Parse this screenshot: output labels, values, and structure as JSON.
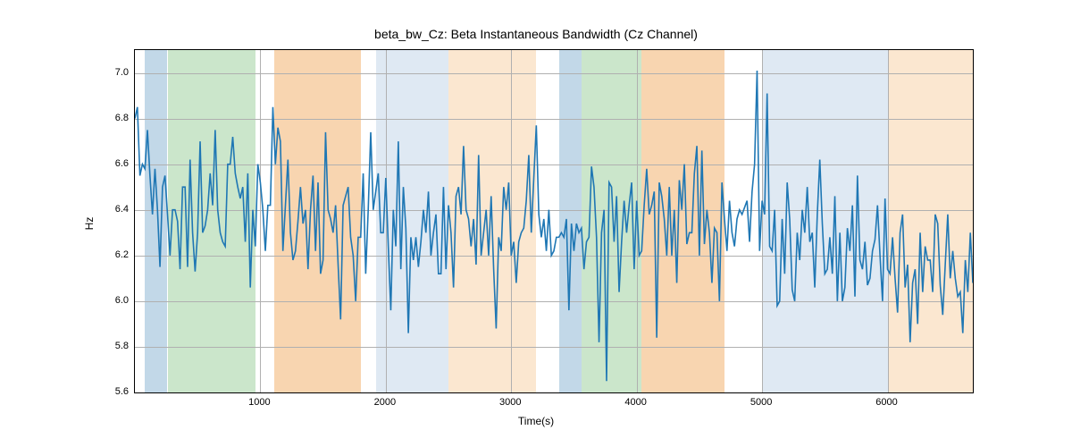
{
  "chart_data": {
    "type": "line",
    "title": "beta_bw_Cz: Beta Instantaneous Bandwidth (Cz Channel)",
    "xlabel": "Time(s)",
    "ylabel": "Hz",
    "xlim": [
      0,
      6680
    ],
    "ylim": [
      5.6,
      7.1
    ],
    "xticks": [
      1000,
      2000,
      3000,
      4000,
      5000,
      6000
    ],
    "yticks": [
      5.6,
      5.8,
      6.0,
      6.2,
      6.4,
      6.6,
      6.8,
      7.0
    ],
    "line_color": "#1f77b4",
    "bands": [
      {
        "x0": 80,
        "x1": 260,
        "color": "#c2d8e8"
      },
      {
        "x0": 260,
        "x1": 960,
        "color": "#cbe6cb"
      },
      {
        "x0": 1110,
        "x1": 1800,
        "color": "#f8d5b0"
      },
      {
        "x0": 1920,
        "x1": 2100,
        "color": "#dfe9f3"
      },
      {
        "x0": 2100,
        "x1": 2500,
        "color": "#dfe9f3"
      },
      {
        "x0": 2500,
        "x1": 3200,
        "color": "#fbe7d0"
      },
      {
        "x0": 3380,
        "x1": 3560,
        "color": "#c2d8e8"
      },
      {
        "x0": 3560,
        "x1": 4040,
        "color": "#cbe6cb"
      },
      {
        "x0": 4040,
        "x1": 4700,
        "color": "#f8d5b0"
      },
      {
        "x0": 5000,
        "x1": 6000,
        "color": "#dfe9f3"
      },
      {
        "x0": 6000,
        "x1": 6680,
        "color": "#fbe7d0"
      }
    ],
    "x": [
      0,
      20,
      40,
      60,
      80,
      100,
      120,
      140,
      160,
      180,
      200,
      220,
      240,
      260,
      280,
      300,
      320,
      340,
      360,
      380,
      400,
      420,
      440,
      460,
      480,
      500,
      520,
      540,
      560,
      580,
      600,
      620,
      640,
      660,
      680,
      700,
      720,
      740,
      760,
      780,
      800,
      820,
      840,
      860,
      880,
      900,
      920,
      940,
      960,
      980,
      1000,
      1020,
      1040,
      1060,
      1080,
      1100,
      1120,
      1140,
      1160,
      1180,
      1200,
      1220,
      1240,
      1260,
      1280,
      1300,
      1320,
      1340,
      1360,
      1380,
      1400,
      1420,
      1440,
      1460,
      1480,
      1500,
      1520,
      1540,
      1560,
      1580,
      1600,
      1620,
      1640,
      1660,
      1680,
      1700,
      1720,
      1740,
      1760,
      1780,
      1800,
      1820,
      1840,
      1860,
      1880,
      1900,
      1920,
      1940,
      1960,
      1980,
      2000,
      2020,
      2040,
      2060,
      2080,
      2100,
      2120,
      2140,
      2160,
      2180,
      2200,
      2220,
      2240,
      2260,
      2280,
      2300,
      2320,
      2340,
      2360,
      2380,
      2400,
      2420,
      2440,
      2460,
      2480,
      2500,
      2520,
      2540,
      2560,
      2580,
      2600,
      2620,
      2640,
      2660,
      2680,
      2700,
      2720,
      2740,
      2760,
      2780,
      2800,
      2820,
      2840,
      2860,
      2880,
      2900,
      2920,
      2940,
      2960,
      2980,
      3000,
      3020,
      3040,
      3060,
      3080,
      3100,
      3120,
      3140,
      3160,
      3180,
      3200,
      3220,
      3240,
      3260,
      3280,
      3300,
      3320,
      3340,
      3360,
      3380,
      3400,
      3420,
      3440,
      3460,
      3480,
      3500,
      3520,
      3540,
      3560,
      3580,
      3600,
      3620,
      3640,
      3660,
      3680,
      3700,
      3720,
      3740,
      3760,
      3780,
      3800,
      3820,
      3840,
      3860,
      3880,
      3900,
      3920,
      3940,
      3960,
      3980,
      4000,
      4020,
      4040,
      4060,
      4080,
      4100,
      4120,
      4140,
      4160,
      4180,
      4200,
      4220,
      4240,
      4260,
      4280,
      4300,
      4320,
      4340,
      4360,
      4380,
      4400,
      4420,
      4440,
      4460,
      4480,
      4500,
      4520,
      4540,
      4560,
      4580,
      4600,
      4620,
      4640,
      4660,
      4680,
      4700,
      4720,
      4740,
      4760,
      4780,
      4800,
      4820,
      4840,
      4860,
      4880,
      4900,
      4920,
      4940,
      4960,
      4980,
      5000,
      5020,
      5040,
      5060,
      5080,
      5100,
      5120,
      5140,
      5160,
      5180,
      5200,
      5220,
      5240,
      5260,
      5280,
      5300,
      5320,
      5340,
      5360,
      5380,
      5400,
      5420,
      5440,
      5460,
      5480,
      5500,
      5520,
      5540,
      5560,
      5580,
      5600,
      5620,
      5640,
      5660,
      5680,
      5700,
      5720,
      5740,
      5760,
      5780,
      5800,
      5820,
      5840,
      5860,
      5880,
      5900,
      5920,
      5940,
      5960,
      5980,
      6000,
      6020,
      6040,
      6060,
      6080,
      6100,
      6120,
      6140,
      6160,
      6180,
      6200,
      6220,
      6240,
      6260,
      6280,
      6300,
      6320,
      6340,
      6360,
      6380,
      6400,
      6420,
      6440,
      6460,
      6480,
      6500,
      6520,
      6540,
      6560,
      6580,
      6600,
      6620,
      6640,
      6660,
      6680
    ],
    "values": [
      6.8,
      6.85,
      6.55,
      6.6,
      6.58,
      6.75,
      6.55,
      6.38,
      6.58,
      6.4,
      6.15,
      6.5,
      6.55,
      6.38,
      6.2,
      6.4,
      6.4,
      6.35,
      6.14,
      6.5,
      6.5,
      6.15,
      6.62,
      6.3,
      6.13,
      6.3,
      6.7,
      6.3,
      6.33,
      6.4,
      6.56,
      6.42,
      6.75,
      6.4,
      6.3,
      6.26,
      6.24,
      6.6,
      6.6,
      6.72,
      6.56,
      6.5,
      6.45,
      6.5,
      6.26,
      6.56,
      6.06,
      6.4,
      6.24,
      6.6,
      6.52,
      6.4,
      6.22,
      6.42,
      6.42,
      6.85,
      6.6,
      6.76,
      6.7,
      6.22,
      6.42,
      6.62,
      6.3,
      6.18,
      6.22,
      6.35,
      6.5,
      6.34,
      6.4,
      6.14,
      6.4,
      6.55,
      6.22,
      6.52,
      6.12,
      6.18,
      6.74,
      6.4,
      6.36,
      6.3,
      6.42,
      6.16,
      5.92,
      6.42,
      6.46,
      6.5,
      6.28,
      6.2,
      6.0,
      6.28,
      6.28,
      6.56,
      6.12,
      6.4,
      6.74,
      6.4,
      6.48,
      6.56,
      6.3,
      6.3,
      6.54,
      6.24,
      5.96,
      6.4,
      6.24,
      6.7,
      6.14,
      6.5,
      6.32,
      5.86,
      6.28,
      6.18,
      6.28,
      6.15,
      6.26,
      6.4,
      6.3,
      6.48,
      6.2,
      6.3,
      6.38,
      6.12,
      6.12,
      6.5,
      6.14,
      6.42,
      6.3,
      6.06,
      6.46,
      6.5,
      6.38,
      6.68,
      6.4,
      6.36,
      6.24,
      6.36,
      6.16,
      6.64,
      6.2,
      6.3,
      6.4,
      6.2,
      6.46,
      6.14,
      5.88,
      6.28,
      6.22,
      6.5,
      6.4,
      6.52,
      6.2,
      6.26,
      6.08,
      6.26,
      6.3,
      6.32,
      6.44,
      6.64,
      6.3,
      6.54,
      6.77,
      6.38,
      6.28,
      6.36,
      6.22,
      6.4,
      6.2,
      6.22,
      6.28,
      6.28,
      6.3,
      6.28,
      6.36,
      5.96,
      6.34,
      6.22,
      6.34,
      6.3,
      6.32,
      6.14,
      6.26,
      6.28,
      6.59,
      6.5,
      6.28,
      5.82,
      6.3,
      6.4,
      5.65,
      6.52,
      6.5,
      6.26,
      6.46,
      6.04,
      6.26,
      6.44,
      6.3,
      6.42,
      6.52,
      6.14,
      6.44,
      6.2,
      6.22,
      6.42,
      6.58,
      6.38,
      6.42,
      6.48,
      5.84,
      6.52,
      6.46,
      6.36,
      6.2,
      6.5,
      6.2,
      6.4,
      6.08,
      6.53,
      6.4,
      6.6,
      6.25,
      6.3,
      6.3,
      6.56,
      6.68,
      6.2,
      6.66,
      6.25,
      6.4,
      6.3,
      6.08,
      6.32,
      6.3,
      6.0,
      6.52,
      6.36,
      6.22,
      6.44,
      6.3,
      6.24,
      6.36,
      6.4,
      6.38,
      6.41,
      6.44,
      6.26,
      6.48,
      6.6,
      7.01,
      6.22,
      6.44,
      6.38,
      6.91,
      6.24,
      6.22,
      6.4,
      5.98,
      6.0,
      6.36,
      6.12,
      6.52,
      6.36,
      6.05,
      6.0,
      6.3,
      6.18,
      6.4,
      6.3,
      6.5,
      6.26,
      6.3,
      6.06,
      6.38,
      6.62,
      6.34,
      6.12,
      6.14,
      6.28,
      6.12,
      6.46,
      6.0,
      6.3,
      6.0,
      6.06,
      6.32,
      6.22,
      6.42,
      6.02,
      6.55,
      6.18,
      6.14,
      6.26,
      6.07,
      6.1,
      6.22,
      6.27,
      6.42,
      6.2,
      6.0,
      6.45,
      6.14,
      6.12,
      6.28,
      6.1,
      5.95,
      6.3,
      6.38,
      6.06,
      6.16,
      5.82,
      6.08,
      6.14,
      5.9,
      6.3,
      6.04,
      6.24,
      6.18,
      6.18,
      6.04,
      6.38,
      6.34,
      6.07,
      5.94,
      6.16,
      6.38,
      6.1,
      6.22,
      6.1,
      6.02,
      6.04,
      5.86,
      6.18,
      6.04,
      6.3,
      6.08
    ]
  }
}
